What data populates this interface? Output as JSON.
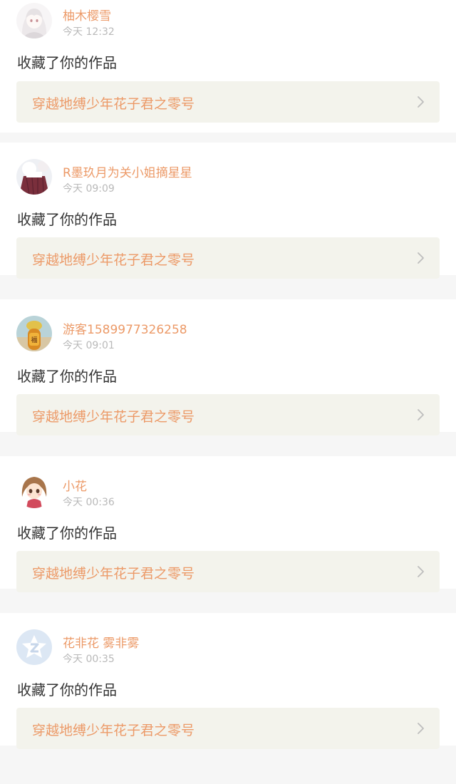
{
  "notifications": [
    {
      "user": "柚木樱雪",
      "time": "今天 12:32",
      "action": "收藏了你的作品",
      "work_title": "穿越地缚少年花子君之零号",
      "avatar_icon": "anime-girl-avatar-icon"
    },
    {
      "user": "R墨玖月为关小姐摘星星",
      "time": "今天 09:09",
      "action": "收藏了你的作品",
      "work_title": "穿越地缚少年花子君之零号",
      "avatar_icon": "skirt-photo-avatar-icon"
    },
    {
      "user": "游客1589977326258",
      "time": "今天 09:01",
      "action": "收藏了你的作品",
      "work_title": "穿越地缚少年花子君之零号",
      "avatar_icon": "lantern-photo-avatar-icon"
    },
    {
      "user": "小花",
      "time": "今天 00:36",
      "action": "收藏了你的作品",
      "work_title": "穿越地缚少年花子君之零号",
      "avatar_icon": "cartoon-girl-avatar-icon"
    },
    {
      "user": "花非花 雾非雾",
      "time": "今天 00:35",
      "action": "收藏了你的作品",
      "work_title": "穿越地缚少年花子君之零号",
      "avatar_icon": "default-qq-avatar-icon"
    }
  ],
  "colors": {
    "accent": "#ec9a68",
    "timestamp": "#b9b9b9",
    "link_background": "#f3f3ec",
    "page_background": "#f6f6f6"
  }
}
